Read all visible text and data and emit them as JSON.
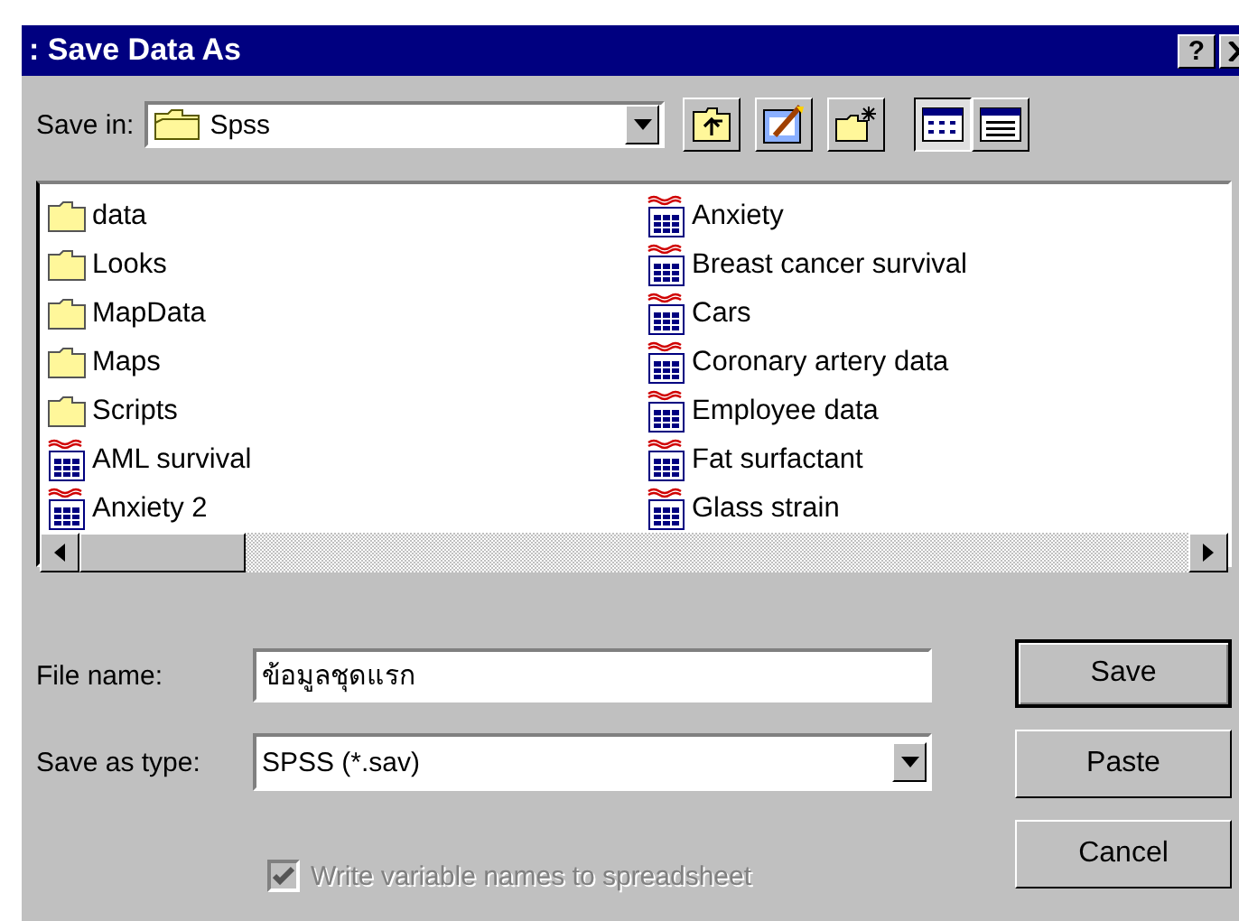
{
  "window": {
    "title": ": Save Data As",
    "help_button": "?"
  },
  "save_in": {
    "label": "Save in:",
    "value": "Spss"
  },
  "toolbar": [
    {
      "kind": "up"
    },
    {
      "kind": "desktop"
    },
    {
      "kind": "new-folder"
    },
    {
      "kind": "list",
      "selected": true
    },
    {
      "kind": "details",
      "selected": false
    }
  ],
  "files": [
    {
      "name": "data",
      "kind": "folder"
    },
    {
      "name": "Looks",
      "kind": "folder"
    },
    {
      "name": "MapData",
      "kind": "folder"
    },
    {
      "name": "Maps",
      "kind": "folder"
    },
    {
      "name": "Scripts",
      "kind": "folder"
    },
    {
      "name": "AML survival",
      "kind": "data"
    },
    {
      "name": "Anxiety 2",
      "kind": "data"
    },
    {
      "name": "Anxiety",
      "kind": "data"
    },
    {
      "name": "Breast cancer survival",
      "kind": "data"
    },
    {
      "name": "Cars",
      "kind": "data"
    },
    {
      "name": "Coronary artery data",
      "kind": "data"
    },
    {
      "name": "Employee data",
      "kind": "data"
    },
    {
      "name": "Fat surfactant",
      "kind": "data"
    },
    {
      "name": "Glass strain",
      "kind": "data"
    }
  ],
  "file_name": {
    "label": "File name:",
    "value": "ข้อมูลชุดแรก"
  },
  "save_as_type": {
    "label": "Save as type:",
    "value": "SPSS (*.sav)"
  },
  "buttons": [
    {
      "label": "Save",
      "default": true
    },
    {
      "label": "Paste",
      "default": false
    },
    {
      "label": "Cancel",
      "default": false
    }
  ],
  "write_names": {
    "label": "Write variable names to spreadsheet",
    "checked": true,
    "disabled": true
  }
}
